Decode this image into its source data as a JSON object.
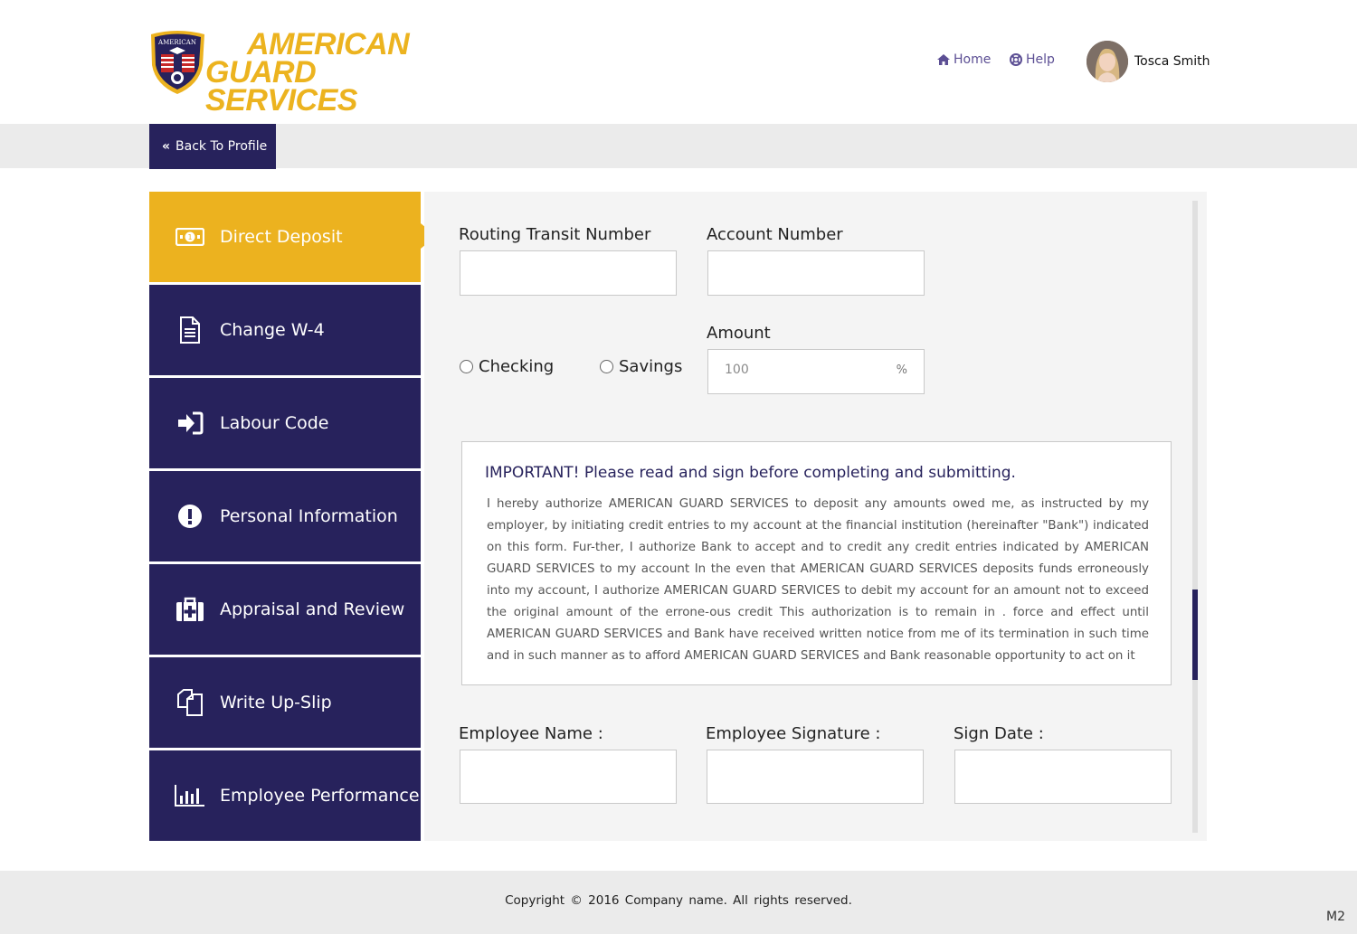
{
  "brand": {
    "line1": "AMERICAN",
    "line2": "GUARD SERVICES",
    "shield_text": "AMERICAN",
    "accent": "#ecb21f",
    "navy": "#27225c"
  },
  "nav": {
    "home": "Home",
    "help": "Help",
    "user_name": "Tosca Smith"
  },
  "back_button": "Back To Profile",
  "sidebar": {
    "items": [
      {
        "label": "Direct Deposit",
        "icon": "money-icon",
        "active": true
      },
      {
        "label": "Change W-4",
        "icon": "document-icon"
      },
      {
        "label": "Labour Code",
        "icon": "sign-in-icon"
      },
      {
        "label": "Personal Information",
        "icon": "exclamation-icon"
      },
      {
        "label": "Appraisal and Review",
        "icon": "medkit-icon"
      },
      {
        "label": "Write Up-Slip",
        "icon": "copy-icon"
      },
      {
        "label": "Employee Performance",
        "icon": "bar-chart-icon"
      }
    ]
  },
  "form": {
    "routing_label": "Routing Transit Number",
    "routing_value": "",
    "account_label": "Account Number",
    "account_value": "",
    "checking_label": "Checking",
    "savings_label": "Savings",
    "amount_label": "Amount",
    "amount_value": "100",
    "amount_unit": "%",
    "employee_name_label": "Employee Name :",
    "employee_signature_label": "Employee Signature :",
    "sign_date_label": "Sign Date :"
  },
  "notice": {
    "title": "IMPORTANT! Please read and sign before completing and submitting.",
    "body": "I hereby authorize AMERICAN GUARD SERVICES to deposit any amounts owed me, as instructed by my employer, by initiating credit entries to my account at the financial institution (hereinafter \"Bank\") indicated on this form. Fur-ther, I authorize Bank to accept and to credit any credit entries indicated by AMERICAN GUARD SERVICES to my account In the even that AMERICAN GUARD SERVICES deposits funds erroneously into my account, I authorize AMERICAN GUARD SERVICES to debit my account for an amount not to exceed the original amount of the errone-ous credit This authorization is to remain in . force and effect until AMERICAN GUARD SERVICES and Bank have received written notice from me of its termination in such time and in such manner as to afford AMERICAN GUARD SERVICES and Bank reasonable opportunity to act on it"
  },
  "footer": {
    "copyright": "Copyright © 2016 Company name. All rights reserved.",
    "mark": "M2"
  }
}
